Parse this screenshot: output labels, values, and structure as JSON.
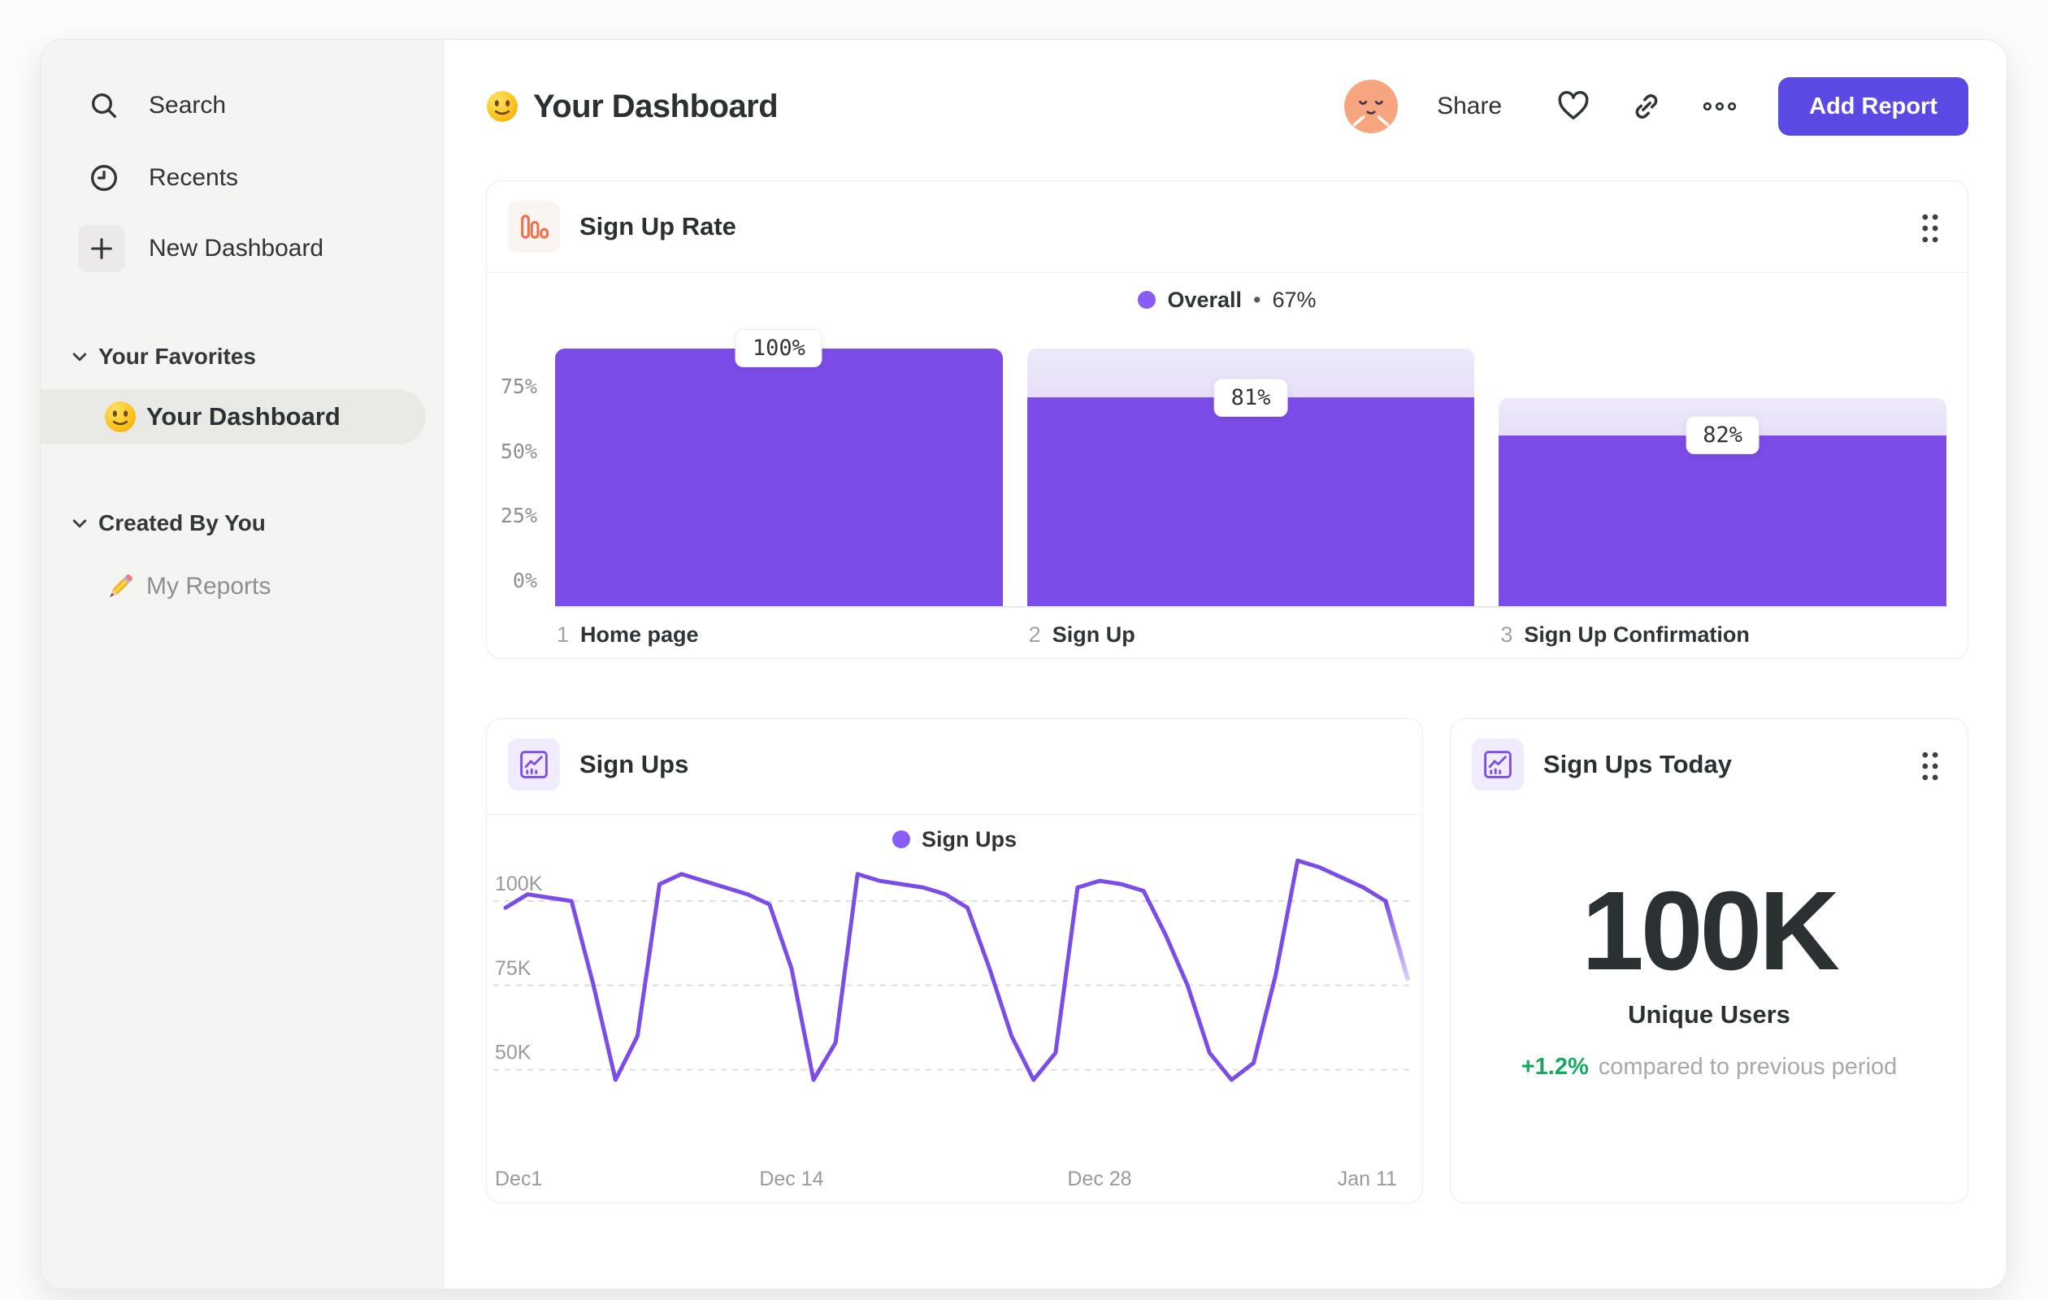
{
  "colors": {
    "accent_purple": "#7c4ce9",
    "legend_dot_purple": "#8a5cf6",
    "button_purple": "#5a49e2",
    "icon_orange": "#f0704c",
    "positive_green": "#18a860",
    "sidebar_bg": "#f4f4f2",
    "text_dark": "#2f3437",
    "text_gray": "#9a9a98"
  },
  "sidebar": {
    "search": "Search",
    "recents": "Recents",
    "new_dashboard": "New Dashboard",
    "favorites_title": "Your Favorites",
    "favorites_item": "Your Dashboard",
    "created_title": "Created By You",
    "created_item": "My Reports"
  },
  "header": {
    "title": "Your Dashboard",
    "share": "Share",
    "add_report": "Add Report"
  },
  "cards": {
    "signup_rate": {
      "title": "Sign Up Rate",
      "legend_label": "Overall",
      "legend_sep": "•",
      "legend_value": "67%"
    },
    "sign_ups": {
      "title": "Sign Ups",
      "legend_label": "Sign Ups"
    },
    "sign_ups_today": {
      "title": "Sign Ups Today",
      "value": "100K",
      "label": "Unique Users",
      "delta": "+1.2%",
      "delta_note": "compared to previous period"
    }
  },
  "chart_data": [
    {
      "type": "bar",
      "subtype": "funnel",
      "title": "Sign Up Rate",
      "legend": "Overall • 67%",
      "overall_conversion_pct": 67,
      "categories": [
        "Home page",
        "Sign Up",
        "Sign Up Confirmation"
      ],
      "step_indices": [
        "1",
        "2",
        "3"
      ],
      "values_pct": [
        100,
        81,
        82
      ],
      "value_labels": [
        "100%",
        "81%",
        "82%"
      ],
      "y_ticks": [
        {
          "label": "75%",
          "value": 75
        },
        {
          "label": "50%",
          "value": 50
        },
        {
          "label": "25%",
          "value": 25
        },
        {
          "label": "0%",
          "value": 0
        }
      ],
      "ylim": [
        0,
        100
      ],
      "grid": "off",
      "legend_position": "top-center"
    },
    {
      "type": "line",
      "title": "Sign Ups",
      "series_name": "Sign Ups",
      "unit": "K",
      "x_tick_labels": [
        "Dec1",
        "Dec 14",
        "Dec 28",
        "Jan 11"
      ],
      "x_tick_days": [
        0,
        13,
        27,
        41
      ],
      "y_ticks": [
        {
          "label": "100K",
          "value": 100
        },
        {
          "label": "75K",
          "value": 75
        },
        {
          "label": "50K",
          "value": 50
        }
      ],
      "ylim": [
        30,
        118
      ],
      "grid": "dashed-horizontal",
      "legend_position": "top-center",
      "values": [
        98,
        102,
        101,
        100,
        75,
        47,
        60,
        105,
        108,
        106,
        104,
        102,
        99,
        80,
        47,
        58,
        108,
        106,
        105,
        104,
        102,
        98,
        80,
        60,
        47,
        55,
        104,
        106,
        105,
        103,
        90,
        75,
        55,
        47,
        52,
        78,
        112,
        110,
        107,
        104,
        100,
        77
      ]
    },
    {
      "type": "table",
      "title": "Sign Ups Today",
      "metric_value": "100K",
      "metric_label": "Unique Users",
      "delta_pct": "+1.2%",
      "delta_note": "compared to previous period"
    }
  ]
}
